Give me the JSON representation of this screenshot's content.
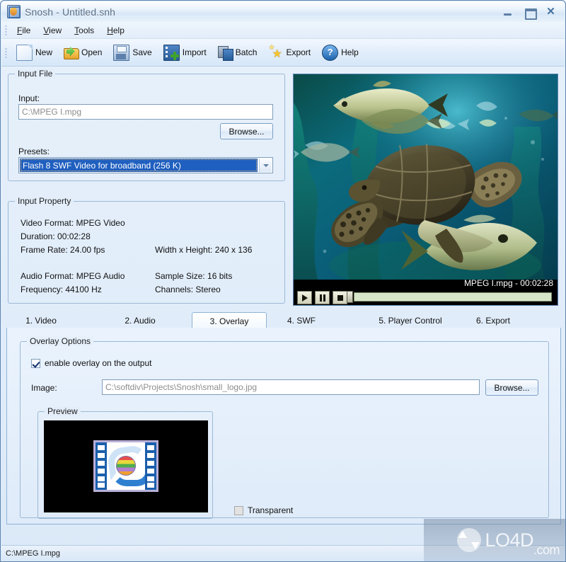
{
  "window": {
    "title": "Snosh - Untitled.snh",
    "icon": "app-icon",
    "minimize": "–",
    "maximize": "□",
    "close": "✕"
  },
  "menu": [
    {
      "label": "File",
      "accel": "F"
    },
    {
      "label": "View",
      "accel": "V"
    },
    {
      "label": "Tools",
      "accel": "T"
    },
    {
      "label": "Help",
      "accel": "H"
    }
  ],
  "toolbar": [
    {
      "label": "New",
      "icon": "new-document-icon"
    },
    {
      "label": "Open",
      "icon": "open-folder-icon"
    },
    {
      "label": "Save",
      "icon": "floppy-disk-icon"
    },
    {
      "label": "Import",
      "icon": "import-film-icon"
    },
    {
      "label": "Batch",
      "icon": "batch-films-icon"
    },
    {
      "label": "Export",
      "icon": "export-stars-icon"
    },
    {
      "label": "Help",
      "icon": "help-question-icon"
    }
  ],
  "input_file": {
    "group_title": "Input File",
    "input_label": "Input:",
    "input_value": "C:\\MPEG I.mpg",
    "browse_label": "Browse...",
    "presets_label": "Presets:",
    "preset_selected": "Flash 8 SWF Video for broadband (256 K)"
  },
  "input_property": {
    "group_title": "Input Property",
    "rows": [
      {
        "left": "Video Format: MPEG Video",
        "right": ""
      },
      {
        "left": "Duration: 00:02:28",
        "right": ""
      },
      {
        "left": "Frame Rate: 24.00 fps",
        "right": "Width x Height: 240 x 136"
      },
      {
        "left": "Audio Format: MPEG Audio",
        "right": "Sample Size: 16 bits"
      },
      {
        "left": "Frequency: 44100 Hz",
        "right": "Channels: Stereo"
      }
    ]
  },
  "player": {
    "status_text": "MPEG I.mpg - 00:02:28",
    "play": "play-button",
    "pause": "pause-button",
    "stop": "stop-button",
    "seek_position_percent": 0
  },
  "tabs": [
    {
      "label": "1. Video",
      "active": false
    },
    {
      "label": "2. Audio",
      "active": false
    },
    {
      "label": "3. Overlay",
      "active": true
    },
    {
      "label": "4. SWF",
      "active": false
    },
    {
      "label": "5. Player Control",
      "active": false
    },
    {
      "label": "6. Export",
      "active": false
    }
  ],
  "overlay": {
    "group_title": "Overlay Options",
    "enable_label": "enable overlay on the output",
    "enable_checked": true,
    "image_label": "Image:",
    "image_value": "C:\\softdiv\\Projects\\Snosh\\small_logo.jpg",
    "browse_label": "Browse...",
    "preview_title": "Preview",
    "transparent_label": "Transparent",
    "transparent_checked": false
  },
  "statusbar": {
    "text": "C:\\MPEG I.mpg"
  },
  "watermark": {
    "text": "LO4D",
    "suffix": ".com"
  },
  "colors": {
    "accent": "#1f5fbf",
    "chrome": "#dbe9f8",
    "group_border": "#9cb9d6",
    "seek_track": "#d7e6c8"
  }
}
